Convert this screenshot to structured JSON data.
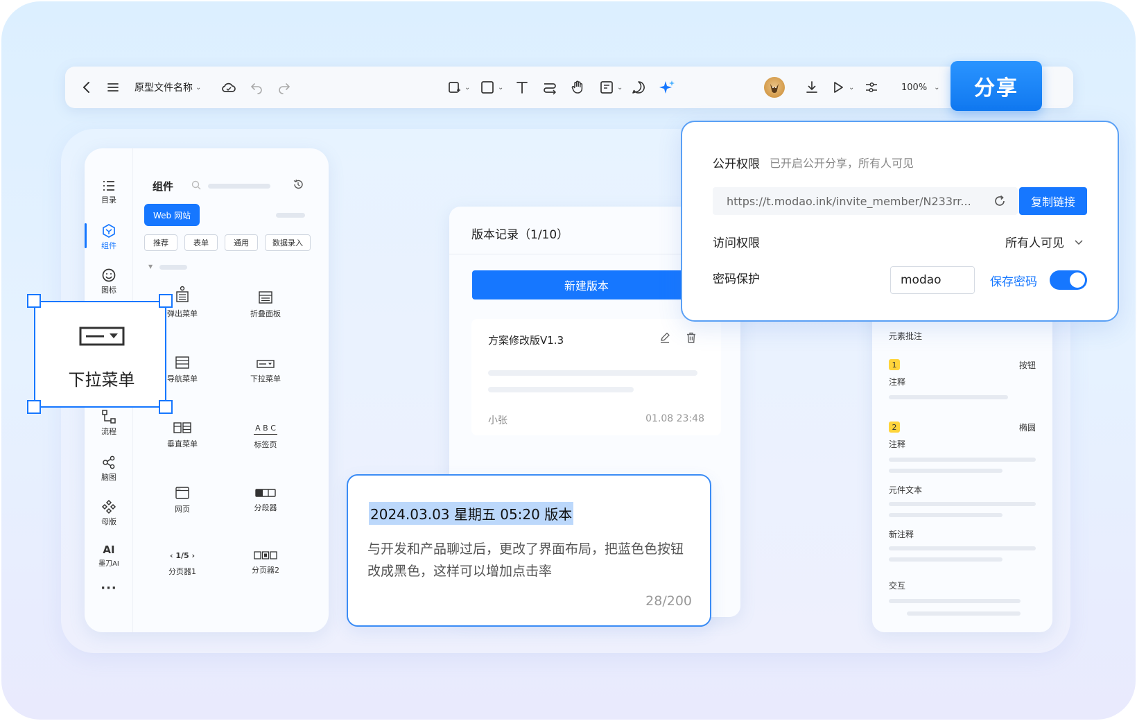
{
  "toolbar": {
    "file_name": "原型文件名称",
    "zoom": "100%",
    "share_label": "分享",
    "icons": [
      "back-icon",
      "menu-icon",
      "cloud-icon",
      "undo-icon",
      "redo-icon",
      "frame-icon",
      "rectangle-icon",
      "text-icon",
      "connector-icon",
      "hand-icon",
      "note-icon",
      "comment-icon",
      "ai-sparkle-icon",
      "avatar",
      "download-icon",
      "play-icon",
      "settings-icon"
    ]
  },
  "sidebar": {
    "rail": [
      {
        "label": "目录",
        "icon": "list-icon"
      },
      {
        "label": "组件",
        "icon": "component-icon"
      },
      {
        "label": "图标",
        "icon": "smile-icon"
      },
      {
        "label": "流程",
        "icon": "flow-icon"
      },
      {
        "label": "脑图",
        "icon": "mindmap-icon"
      },
      {
        "label": "母版",
        "icon": "master-icon"
      },
      {
        "label": "墨刀AI",
        "icon": "ai-icon",
        "glyph": "AI"
      },
      {
        "label": "···",
        "icon": "more-icon"
      }
    ],
    "title": "组件",
    "web_tag": "Web 网站",
    "chips": [
      "推荐",
      "表单",
      "通用",
      "数据录入"
    ],
    "components": [
      {
        "label": "弹出菜单",
        "icon": "popup-menu-icon"
      },
      {
        "label": "折叠面板",
        "icon": "collapse-panel-icon"
      },
      {
        "label": "导航菜单",
        "icon": "nav-menu-icon"
      },
      {
        "label": "下拉菜单",
        "icon": "dropdown-menu-icon"
      },
      {
        "label": "垂直菜单",
        "icon": "vertical-menu-icon"
      },
      {
        "label": "标签页",
        "icon": "tabs-icon",
        "glyph": "A B C"
      },
      {
        "label": "网页",
        "icon": "webpage-icon"
      },
      {
        "label": "分段器",
        "icon": "segment-icon"
      },
      {
        "label": "分页器1",
        "icon": "pager1-icon",
        "glyph": "‹ 1/5 ›"
      },
      {
        "label": "分页器2",
        "icon": "pager2-icon"
      }
    ]
  },
  "selection": {
    "label": "下拉菜单"
  },
  "version_panel": {
    "title": "版本记录（1/10）",
    "new_button": "新建版本",
    "card": {
      "name": "方案修改版V1.3",
      "author": "小张",
      "time": "01.08 23:48"
    }
  },
  "note": {
    "title": "2024.03.03 星期五 05:20 版本",
    "body": "与开发和产品聊过后，更改了界面布局，把蓝色色按钮改成黑色，这样可以增加点击率",
    "count": "28/200"
  },
  "annotations": {
    "header": "元素批注",
    "items": [
      {
        "num": "1",
        "tag": "按钮",
        "label": "注释"
      },
      {
        "num": "2",
        "tag": "椭圆",
        "label": "注释"
      }
    ],
    "sections": [
      "元件文本",
      "新注释",
      "交互"
    ]
  },
  "share_popover": {
    "public_label": "公开权限",
    "public_status": "已开启公开分享，所有人可见",
    "link": "https://t.modao.ink/invite_member/N233rr...",
    "copy_label": "复制链接",
    "access_label": "访问权限",
    "access_value": "所有人可见",
    "password_label": "密码保护",
    "password_value": "modao",
    "save_password": "保存密码",
    "password_enabled": true
  },
  "colors": {
    "accent": "#1677ff",
    "badge": "#ffd43b"
  }
}
